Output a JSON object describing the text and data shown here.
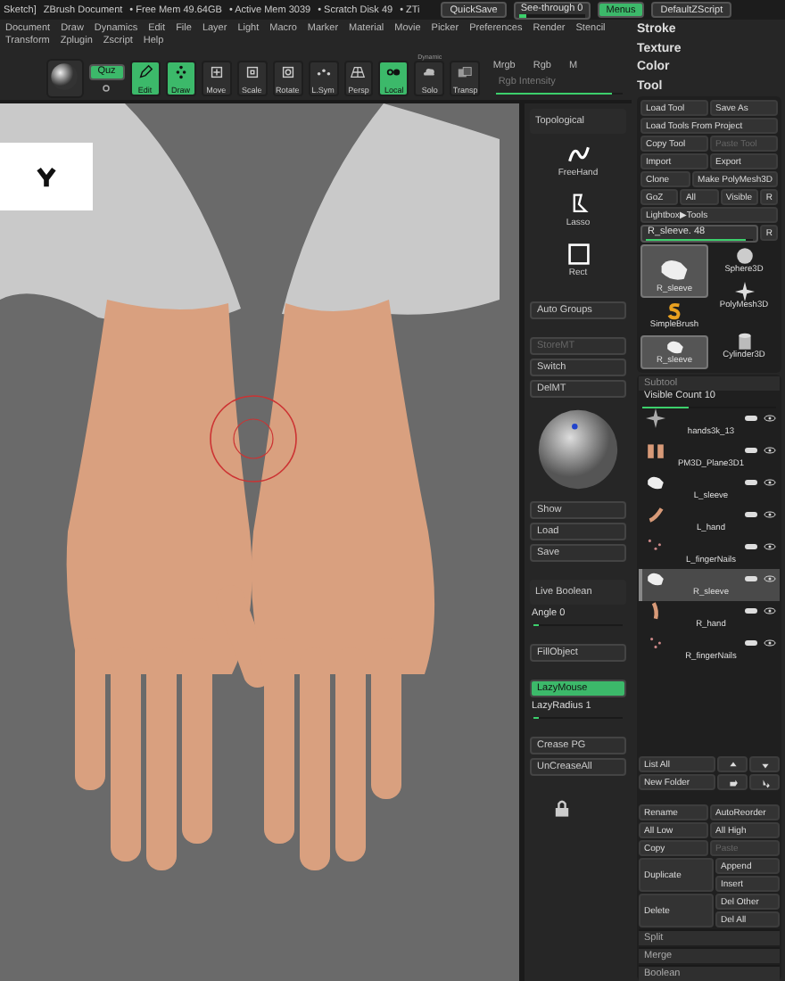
{
  "title_bar": {
    "items": [
      "Sketch]",
      "ZBrush Document",
      "• Free Mem 49.64GB",
      "• Active Mem 3039",
      "• Scratch Disk 49",
      "• ZTi"
    ],
    "quicksave": "QuickSave",
    "see_through": {
      "label": "See-through 0",
      "level": 0.1
    },
    "menus_button": {
      "label": "Menus",
      "selected": true
    },
    "script": "DefaultZScript"
  },
  "menu_bar": [
    "Document",
    "Draw",
    "Dynamics",
    "Edit",
    "File",
    "Layer",
    "Light",
    "Macro",
    "Marker",
    "Material",
    "Movie",
    "Picker",
    "Preferences",
    "Render",
    "Stencil",
    "Transform",
    "Zplugin",
    "Zscript",
    "Help"
  ],
  "toolbar": {
    "buttons": [
      {
        "kind": "material",
        "active": false
      },
      {
        "kind": "toggle",
        "label": "Quz",
        "active": true
      },
      {
        "kind": "tool",
        "label": "Edit",
        "active": true
      },
      {
        "kind": "tool",
        "label": "Draw",
        "active": true
      },
      {
        "kind": "tool",
        "label": "Move",
        "active": false
      },
      {
        "kind": "tool",
        "label": "Scale",
        "active": false
      },
      {
        "kind": "tool",
        "label": "Rotate",
        "active": false
      },
      {
        "kind": "tool",
        "label": "L.Sym",
        "active": false
      },
      {
        "kind": "tool",
        "label": "Persp",
        "active": false
      },
      {
        "kind": "tool",
        "label": "Local",
        "active": true
      },
      {
        "kind": "tool",
        "label": "Solo",
        "caption": "Dynamic",
        "active": false
      },
      {
        "kind": "tool",
        "label": "Transp",
        "active": false
      }
    ],
    "color_modes": [
      "Mrgb",
      "Rgb",
      "M"
    ],
    "rgb_intensity": {
      "label": "Rgb Intensity",
      "level": 0.92
    }
  },
  "side_column": [
    {
      "kind": "label",
      "label": "Topological"
    },
    {
      "kind": "stroke",
      "label": "FreeHand"
    },
    {
      "kind": "stroke",
      "label": "Lasso"
    },
    {
      "kind": "stroke",
      "label": "Rect"
    },
    {
      "kind": "gap"
    },
    {
      "kind": "button",
      "label": "Auto Groups",
      "active": false,
      "disabled": false
    },
    {
      "kind": "gap"
    },
    {
      "kind": "button",
      "label": "StoreMT",
      "active": false,
      "disabled": true
    },
    {
      "kind": "button",
      "label": "Switch",
      "active": false,
      "disabled": false
    },
    {
      "kind": "button",
      "label": "DelMT",
      "active": false,
      "disabled": false
    },
    {
      "kind": "material"
    },
    {
      "kind": "button",
      "label": "Show",
      "active": false,
      "disabled": false
    },
    {
      "kind": "button",
      "label": "Load",
      "active": false,
      "disabled": false
    },
    {
      "kind": "button",
      "label": "Save",
      "active": false,
      "disabled": false
    },
    {
      "kind": "gap"
    },
    {
      "kind": "label",
      "label": "Live Boolean"
    },
    {
      "kind": "slider",
      "label": "Angle 0",
      "level": 0.05
    },
    {
      "kind": "gap"
    },
    {
      "kind": "button",
      "label": "FillObject",
      "active": false,
      "disabled": false
    },
    {
      "kind": "gap"
    },
    {
      "kind": "button",
      "label": "LazyMouse",
      "active": true,
      "disabled": false
    },
    {
      "kind": "slider",
      "label": "LazyRadius 1",
      "level": 0.05
    },
    {
      "kind": "gap"
    },
    {
      "kind": "button",
      "label": "Crease PG",
      "active": false,
      "disabled": false
    },
    {
      "kind": "button",
      "label": "UnCreaseAll",
      "active": false,
      "disabled": false
    },
    {
      "kind": "lock"
    }
  ],
  "palettes": [
    "Stroke",
    "Texture",
    "Color",
    "Tool"
  ],
  "tool": {
    "rows": [
      [
        {
          "label": "Load Tool",
          "disabled": false
        },
        {
          "label": "Save As",
          "disabled": false
        }
      ],
      [
        {
          "label": "Load Tools From Project",
          "disabled": false
        }
      ],
      [
        {
          "label": "Copy Tool",
          "disabled": false
        },
        {
          "label": "Paste Tool",
          "disabled": true
        }
      ],
      [
        {
          "label": "Import",
          "disabled": false
        },
        {
          "label": "Export",
          "disabled": false
        }
      ],
      [
        {
          "label": "Clone",
          "disabled": false
        },
        {
          "label": "Make PolyMesh3D",
          "disabled": false
        }
      ],
      [
        {
          "label": "GoZ",
          "disabled": false
        },
        {
          "label": "All",
          "disabled": false
        },
        {
          "label": "Visible",
          "disabled": false
        },
        {
          "label": "R",
          "disabled": false
        }
      ],
      [
        {
          "label": "Lightbox▶Tools",
          "disabled": false
        }
      ]
    ],
    "current": {
      "label": "R_sleeve. 48",
      "level": 0.93,
      "button": "R"
    },
    "thumbnail_columns": [
      [
        {
          "label": "R_sleeve",
          "selected": true
        },
        {
          "label": "SimpleBrush",
          "selected": false
        },
        {
          "label": "R_sleeve",
          "selected": true
        }
      ],
      [
        {
          "label": "Sphere3D",
          "selected": false
        },
        {
          "label": "PolyMesh3D",
          "selected": false
        },
        {
          "label": "Cylinder3D",
          "selected": false
        }
      ]
    ]
  },
  "subtool": {
    "title": "Subtool",
    "visible_count": {
      "label": "Visible Count 10",
      "level": 0.35
    },
    "items": [
      {
        "name": "hands3k_13",
        "selected": false
      },
      {
        "name": "PM3D_Plane3D1",
        "selected": false
      },
      {
        "name": "L_sleeve",
        "selected": false
      },
      {
        "name": "L_hand",
        "selected": false
      },
      {
        "name": "L_fingerNails",
        "selected": false
      },
      {
        "name": "R_sleeve",
        "selected": true
      },
      {
        "name": "R_hand",
        "selected": false
      },
      {
        "name": "R_fingerNails",
        "selected": false
      }
    ],
    "list_rows": [
      [
        {
          "kind": "text",
          "label": "List All"
        },
        {
          "kind": "up"
        },
        {
          "kind": "down"
        }
      ],
      [
        {
          "kind": "text",
          "label": "New Folder"
        },
        {
          "kind": "move-up"
        },
        {
          "kind": "move-down"
        }
      ]
    ],
    "actions": [
      [
        {
          "label": "Rename",
          "disabled": false
        },
        {
          "label": "AutoReorder",
          "disabled": false
        }
      ],
      [
        {
          "label": "All Low",
          "disabled": false
        },
        {
          "label": "All High",
          "disabled": false
        }
      ],
      [
        {
          "label": "Copy",
          "disabled": false
        },
        {
          "label": "Paste",
          "disabled": true
        }
      ]
    ],
    "tall_actions": [
      {
        "label": "Duplicate",
        "side": [
          {
            "label": "Append",
            "disabled": false
          },
          {
            "label": "Insert",
            "disabled": false
          }
        ]
      },
      {
        "label": "Delete",
        "side": [
          {
            "label": "Del Other",
            "disabled": false
          },
          {
            "label": "Del All",
            "disabled": false
          }
        ]
      }
    ],
    "sections": [
      "Split",
      "Merge",
      "Boolean"
    ]
  }
}
